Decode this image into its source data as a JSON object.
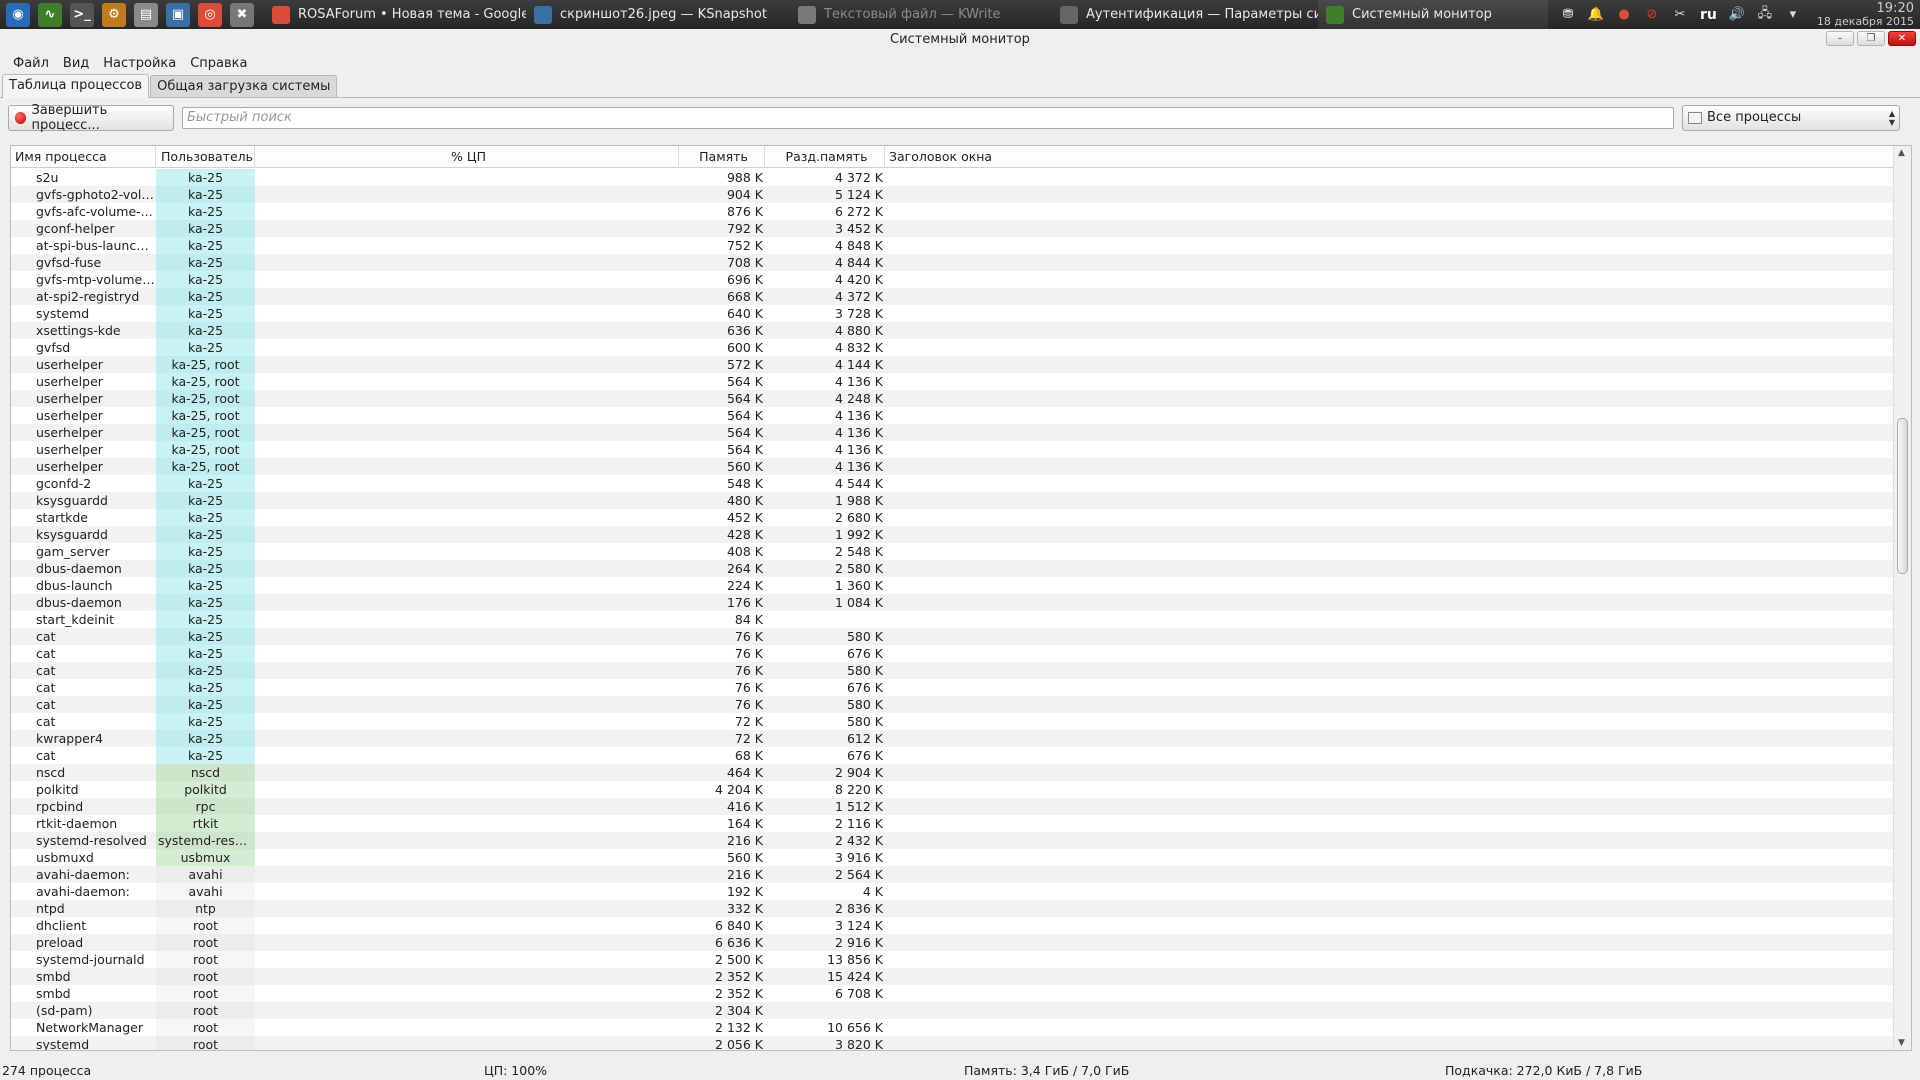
{
  "taskbar": {
    "launchers": [
      {
        "icon": "rosa-menu-icon",
        "color": "#2a6bb8"
      },
      {
        "icon": "system-monitor-launcher-icon",
        "color": "#3f7f2a"
      },
      {
        "icon": "terminal-icon",
        "color": "#555555"
      },
      {
        "icon": "package-manager-icon",
        "color": "#c07a20"
      },
      {
        "icon": "file-manager-icon",
        "color": "#8a8a8a"
      },
      {
        "icon": "ksnapshot-launcher-icon",
        "color": "#3a6fa5"
      },
      {
        "icon": "chrome-icon",
        "color": "#dd4b39"
      },
      {
        "icon": "settings-tools-icon",
        "color": "#777777"
      }
    ],
    "tasks": [
      {
        "label": "ROSAForum • Новая тема - Google",
        "icon": "chrome-icon",
        "state": "normal"
      },
      {
        "label": "скриншот26.jpeg — KSnapshot",
        "icon": "ksnapshot-icon",
        "state": "normal"
      },
      {
        "label": "Текстовый файл — KWrite",
        "icon": "kwrite-icon",
        "state": "dim"
      },
      {
        "label": "Аутентификация — Параметры си",
        "icon": "system-settings-icon",
        "state": "normal"
      },
      {
        "label": "Системный монитор",
        "icon": "system-monitor-icon",
        "state": "active"
      }
    ],
    "tray": {
      "lang": "ru",
      "time": "19:20",
      "date": "18 декабря 2015"
    }
  },
  "window": {
    "title": "Системный монитор",
    "menu": [
      "Файл",
      "Вид",
      "Настройка",
      "Справка"
    ],
    "tabs": [
      "Таблица процессов",
      "Общая загрузка системы"
    ],
    "active_tab": 0
  },
  "toolbar": {
    "kill_label": "Завершить процесс...",
    "search_placeholder": "Быстрый поиск",
    "search_value": "",
    "filter_value": "Все процессы"
  },
  "table": {
    "headers": {
      "name": "Имя процесса",
      "user": "Пользователь",
      "cpu": "% ЦП",
      "mem": "Память",
      "shared": "Разд.память",
      "window": "Заголовок окна"
    },
    "rows": [
      {
        "name": "s2u",
        "user": "ka-25",
        "utype": "user",
        "mem": "988 K",
        "shr": "4 372 K"
      },
      {
        "name": "gvfs-gphoto2-volu...",
        "user": "ka-25",
        "utype": "user",
        "mem": "904 K",
        "shr": "5 124 K"
      },
      {
        "name": "gvfs-afc-volume-...",
        "user": "ka-25",
        "utype": "user",
        "mem": "876 K",
        "shr": "6 272 K"
      },
      {
        "name": "gconf-helper",
        "user": "ka-25",
        "utype": "user",
        "mem": "792 K",
        "shr": "3 452 K"
      },
      {
        "name": "at-spi-bus-launcher",
        "user": "ka-25",
        "utype": "user",
        "mem": "752 K",
        "shr": "4 848 K"
      },
      {
        "name": "gvfsd-fuse",
        "user": "ka-25",
        "utype": "user",
        "mem": "708 K",
        "shr": "4 844 K"
      },
      {
        "name": "gvfs-mtp-volume-...",
        "user": "ka-25",
        "utype": "user",
        "mem": "696 K",
        "shr": "4 420 K"
      },
      {
        "name": "at-spi2-registryd",
        "user": "ka-25",
        "utype": "user",
        "mem": "668 K",
        "shr": "4 372 K"
      },
      {
        "name": "systemd",
        "user": "ka-25",
        "utype": "user",
        "mem": "640 K",
        "shr": "3 728 K"
      },
      {
        "name": "xsettings-kde",
        "user": "ka-25",
        "utype": "user",
        "mem": "636 K",
        "shr": "4 880 K"
      },
      {
        "name": "gvfsd",
        "user": "ka-25",
        "utype": "user",
        "mem": "600 K",
        "shr": "4 832 K"
      },
      {
        "name": "userhelper",
        "user": "ka-25, root",
        "utype": "user",
        "mem": "572 K",
        "shr": "4 144 K"
      },
      {
        "name": "userhelper",
        "user": "ka-25, root",
        "utype": "user",
        "mem": "564 K",
        "shr": "4 136 K"
      },
      {
        "name": "userhelper",
        "user": "ka-25, root",
        "utype": "user",
        "mem": "564 K",
        "shr": "4 248 K"
      },
      {
        "name": "userhelper",
        "user": "ka-25, root",
        "utype": "user",
        "mem": "564 K",
        "shr": "4 136 K"
      },
      {
        "name": "userhelper",
        "user": "ka-25, root",
        "utype": "user",
        "mem": "564 K",
        "shr": "4 136 K"
      },
      {
        "name": "userhelper",
        "user": "ka-25, root",
        "utype": "user",
        "mem": "564 K",
        "shr": "4 136 K"
      },
      {
        "name": "userhelper",
        "user": "ka-25, root",
        "utype": "user",
        "mem": "560 K",
        "shr": "4 136 K"
      },
      {
        "name": "gconfd-2",
        "user": "ka-25",
        "utype": "user",
        "mem": "548 K",
        "shr": "4 544 K"
      },
      {
        "name": "ksysguardd",
        "user": "ka-25",
        "utype": "user",
        "mem": "480 K",
        "shr": "1 988 K"
      },
      {
        "name": "startkde",
        "user": "ka-25",
        "utype": "user",
        "mem": "452 K",
        "shr": "2 680 K"
      },
      {
        "name": "ksysguardd",
        "user": "ka-25",
        "utype": "user",
        "mem": "428 K",
        "shr": "1 992 K"
      },
      {
        "name": "gam_server",
        "user": "ka-25",
        "utype": "user",
        "mem": "408 K",
        "shr": "2 548 K"
      },
      {
        "name": "dbus-daemon",
        "user": "ka-25",
        "utype": "user",
        "mem": "264 K",
        "shr": "2 580 K"
      },
      {
        "name": "dbus-launch",
        "user": "ka-25",
        "utype": "user",
        "mem": "224 K",
        "shr": "1 360 K"
      },
      {
        "name": "dbus-daemon",
        "user": "ka-25",
        "utype": "user",
        "mem": "176 K",
        "shr": "1 084 K"
      },
      {
        "name": "start_kdeinit",
        "user": "ka-25",
        "utype": "user",
        "mem": "84 K",
        "shr": ""
      },
      {
        "name": "cat",
        "user": "ka-25",
        "utype": "user",
        "mem": "76 K",
        "shr": "580 K"
      },
      {
        "name": "cat",
        "user": "ka-25",
        "utype": "user",
        "mem": "76 K",
        "shr": "676 K"
      },
      {
        "name": "cat",
        "user": "ka-25",
        "utype": "user",
        "mem": "76 K",
        "shr": "580 K"
      },
      {
        "name": "cat",
        "user": "ka-25",
        "utype": "user",
        "mem": "76 K",
        "shr": "676 K"
      },
      {
        "name": "cat",
        "user": "ka-25",
        "utype": "user",
        "mem": "76 K",
        "shr": "580 K"
      },
      {
        "name": "cat",
        "user": "ka-25",
        "utype": "user",
        "mem": "72 K",
        "shr": "580 K"
      },
      {
        "name": "kwrapper4",
        "user": "ka-25",
        "utype": "user",
        "mem": "72 K",
        "shr": "612 K"
      },
      {
        "name": "cat",
        "user": "ka-25",
        "utype": "user",
        "mem": "68 K",
        "shr": "676 K"
      },
      {
        "name": "nscd",
        "user": "nscd",
        "utype": "sys",
        "mem": "464 K",
        "shr": "2 904 K"
      },
      {
        "name": "polkitd",
        "user": "polkitd",
        "utype": "sys",
        "mem": "4 204 K",
        "shr": "8 220 K"
      },
      {
        "name": "rpcbind",
        "user": "rpc",
        "utype": "sys",
        "mem": "416 K",
        "shr": "1 512 K"
      },
      {
        "name": "rtkit-daemon",
        "user": "rtkit",
        "utype": "sys",
        "mem": "164 K",
        "shr": "2 116 K"
      },
      {
        "name": "systemd-resolved",
        "user": "systemd-resol...",
        "utype": "sys",
        "mem": "216 K",
        "shr": "2 432 K"
      },
      {
        "name": "usbmuxd",
        "user": "usbmux",
        "utype": "sys",
        "mem": "560 K",
        "shr": "3 916 K"
      },
      {
        "name": "avahi-daemon:",
        "user": "avahi",
        "utype": "other",
        "mem": "216 K",
        "shr": "2 564 K"
      },
      {
        "name": "avahi-daemon:",
        "user": "avahi",
        "utype": "other",
        "mem": "192 K",
        "shr": "4 K"
      },
      {
        "name": "ntpd",
        "user": "ntp",
        "utype": "other",
        "mem": "332 K",
        "shr": "2 836 K"
      },
      {
        "name": "dhclient",
        "user": "root",
        "utype": "other",
        "mem": "6 840 K",
        "shr": "3 124 K"
      },
      {
        "name": "preload",
        "user": "root",
        "utype": "other",
        "mem": "6 636 K",
        "shr": "2 916 K"
      },
      {
        "name": "systemd-journald",
        "user": "root",
        "utype": "other",
        "mem": "2 500 K",
        "shr": "13 856 K"
      },
      {
        "name": "smbd",
        "user": "root",
        "utype": "other",
        "mem": "2 352 K",
        "shr": "15 424 K"
      },
      {
        "name": "smbd",
        "user": "root",
        "utype": "other",
        "mem": "2 352 K",
        "shr": "6 708 K"
      },
      {
        "name": "(sd-pam)",
        "user": "root",
        "utype": "other",
        "mem": "2 304 K",
        "shr": ""
      },
      {
        "name": "NetworkManager",
        "user": "root",
        "utype": "other",
        "mem": "2 132 K",
        "shr": "10 656 K"
      },
      {
        "name": "systemd",
        "user": "root",
        "utype": "other",
        "mem": "2 056 K",
        "shr": "3 820 K"
      }
    ]
  },
  "status": {
    "processes": "274 процесса",
    "cpu": "ЦП: 100%",
    "memory": "Память: 3,4 ГиБ / 7,0 ГиБ",
    "swap": "Подкачка: 272,0 КиБ / 7,8 ГиБ"
  }
}
